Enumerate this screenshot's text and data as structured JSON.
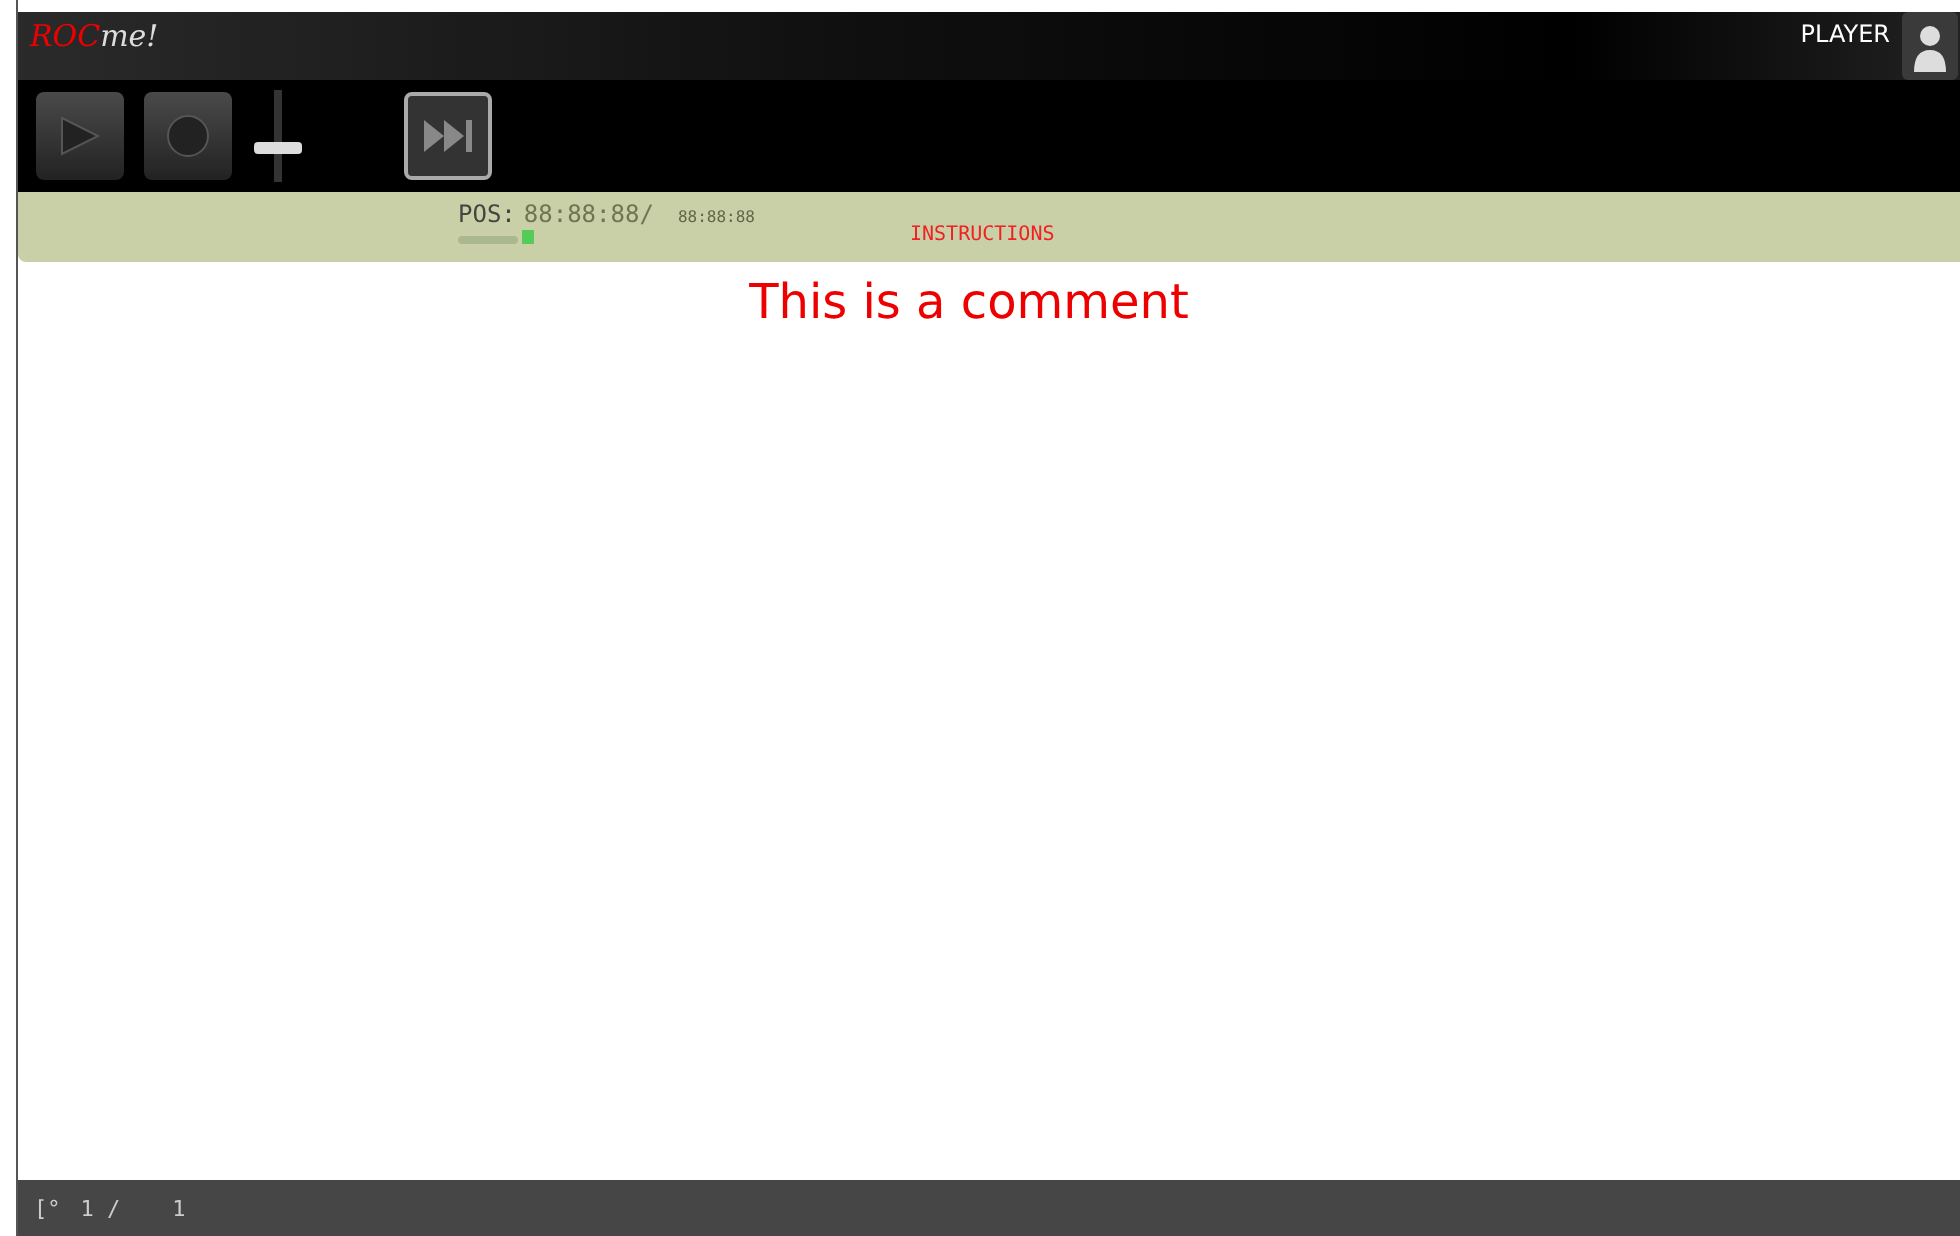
{
  "app": {
    "logo_red": "ROC",
    "logo_rest": "me!"
  },
  "user": {
    "label": "PLAYER"
  },
  "toolbar": {
    "buttons": [
      {
        "kind": "play",
        "disabled": true
      },
      {
        "kind": "record",
        "disabled": true
      },
      {
        "kind": "next",
        "disabled": false
      }
    ],
    "volume": {
      "level": 0.35
    }
  },
  "position": {
    "label": "POS:",
    "current": "88:88:88/",
    "total": "88:88:88"
  },
  "instructions": "INSTRUCTIONS",
  "comment": "This is a comment",
  "status_bar": [
    "[°",
    "1 /",
    "1"
  ]
}
